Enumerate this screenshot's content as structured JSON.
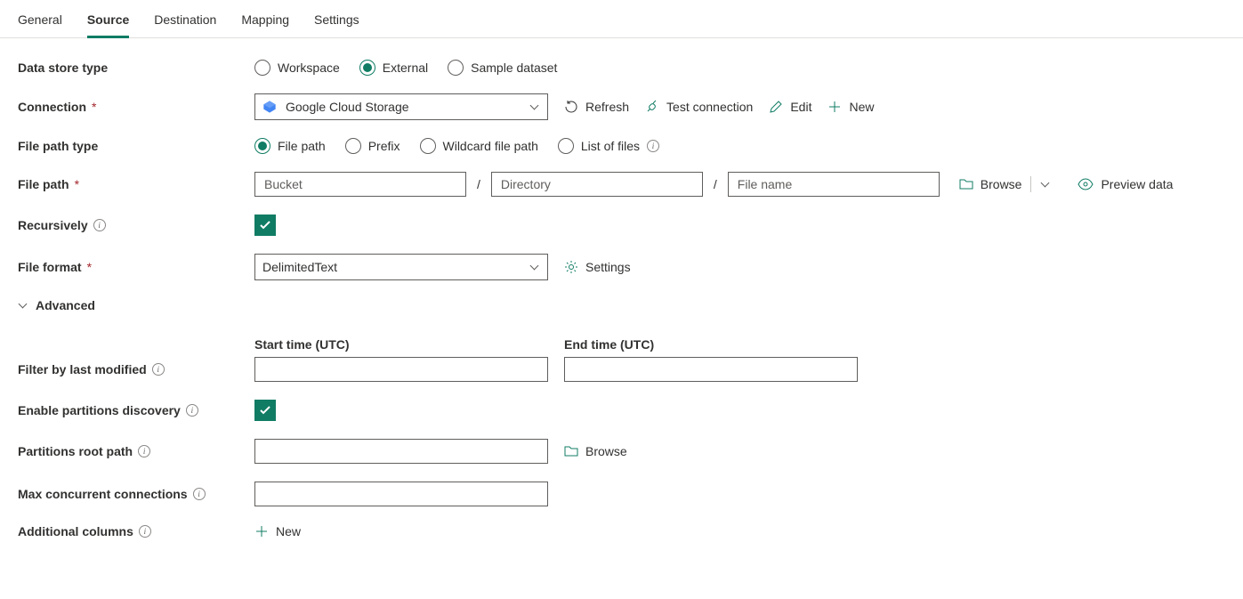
{
  "tabs": {
    "general": "General",
    "source": "Source",
    "destination": "Destination",
    "mapping": "Mapping",
    "settings": "Settings"
  },
  "labels": {
    "data_store_type": "Data store type",
    "connection": "Connection",
    "file_path_type": "File path type",
    "file_path": "File path",
    "recursively": "Recursively",
    "file_format": "File format",
    "advanced": "Advanced",
    "filter_by_last_modified": "Filter by last modified",
    "enable_partitions_discovery": "Enable partitions discovery",
    "partitions_root_path": "Partitions root path",
    "max_concurrent_connections": "Max concurrent connections",
    "additional_columns": "Additional columns"
  },
  "data_store_type": {
    "workspace": "Workspace",
    "external": "External",
    "sample_dataset": "Sample dataset"
  },
  "connection": {
    "selected": "Google Cloud Storage",
    "refresh": "Refresh",
    "test": "Test connection",
    "edit": "Edit",
    "new": "New"
  },
  "file_path_type": {
    "file_path": "File path",
    "prefix": "Prefix",
    "wildcard": "Wildcard file path",
    "list_files": "List of files"
  },
  "file_path_inputs": {
    "bucket_ph": "Bucket",
    "directory_ph": "Directory",
    "filename_ph": "File name",
    "browse": "Browse",
    "preview": "Preview data"
  },
  "file_format": {
    "selected": "DelimitedText",
    "settings": "Settings"
  },
  "time": {
    "start_label": "Start time (UTC)",
    "end_label": "End time (UTC)"
  },
  "partitions_root": {
    "browse": "Browse"
  },
  "additional_columns": {
    "new": "New"
  }
}
